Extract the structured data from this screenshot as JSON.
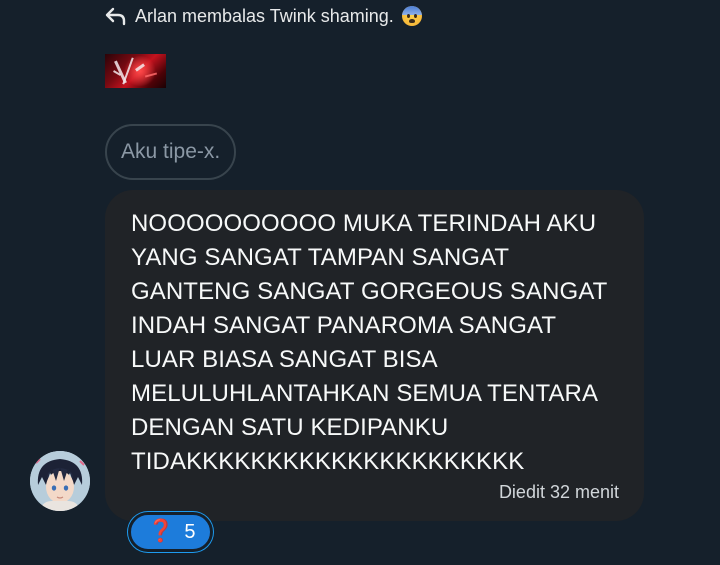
{
  "reply_context": {
    "text": "Arlan membalas Twink shaming.",
    "icon": "reply-arrow-icon",
    "emoji": "fearful-face-emoji"
  },
  "quoted_message": {
    "text": "Aku tipe-x."
  },
  "message": {
    "text": "NOOOOOOOOOO MUKA TERINDAH AKU\nYANG SANGAT TAMPAN SANGAT\nGANTENG SANGAT GORGEOUS SANGAT\nINDAH SANGAT PANAROMA SANGAT\nLUAR BIASA SANGAT BISA\nMELULUHLANTAHKAN SEMUA TENTARA\nDENGAN SATU KEDIPANKU\nTIDAKKKKKKKKKKKKKKKKKKKKK",
    "edited_label": "Diedit 32 menit"
  },
  "reaction": {
    "emoji": "❓",
    "count": "5"
  },
  "colors": {
    "background": "#15202b",
    "bubble": "#202327",
    "reaction": "#1d7cdb",
    "muted_text": "#8b98a5"
  }
}
